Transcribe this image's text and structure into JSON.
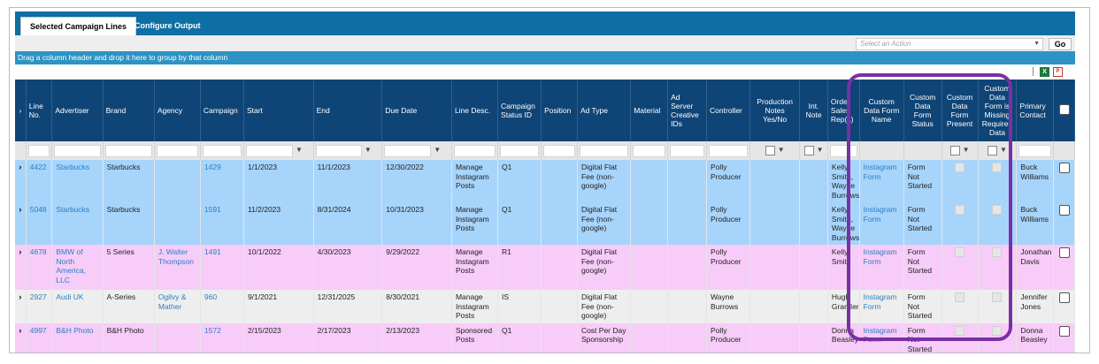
{
  "tabs": [
    {
      "label": "Selected Campaign Lines",
      "active": true
    },
    {
      "label": "Configure Output",
      "active": false
    }
  ],
  "action": {
    "placeholder": "Select an Action",
    "go_label": "Go"
  },
  "group_hint": "Drag a column header and drop it here to group by that column",
  "export": {
    "excel_icon": "excel-icon",
    "pdf_icon": "pdf-icon"
  },
  "columns": {
    "line_no": "Line No.",
    "advertiser": "Advertiser",
    "brand": "Brand",
    "agency": "Agency",
    "campaign": "Campaign",
    "start": "Start",
    "end": "End",
    "due_date": "Due Date",
    "line_desc": "Line Desc.",
    "campaign_status_id": "Campaign Status ID",
    "position": "Position",
    "ad_type": "Ad Type",
    "material": "Material",
    "ad_server_creative_ids": "Ad Server Creative IDs",
    "controller": "Controller",
    "production_notes": "Production Notes Yes/No",
    "int_note": "Int. Note",
    "order_sales_reps": "Order Sales Rep(s)",
    "custom_data_form_name": "Custom Data Form Name",
    "custom_data_form_status": "Custom Data Form Status",
    "custom_data_form_present": "Custom Data Form Present",
    "custom_data_form_missing": "Custom Data Form is Missing Required Data",
    "primary_contact": "Primary Contact"
  },
  "rows": [
    {
      "line_no": "4422",
      "advertiser": "Starbucks",
      "brand": "Starbucks",
      "agency": "",
      "campaign": "1429",
      "start": "1/1/2023",
      "end": "11/1/2023",
      "due_date": "12/30/2022",
      "line_desc": "Manage Instagram Posts",
      "status_id": "Q1",
      "position": "",
      "ad_type": "Digital Flat Fee (non-google)",
      "material": "",
      "ad_server": "",
      "controller": "Polly Producer",
      "prod_notes": "",
      "int_note": "",
      "sales_reps": "Kelly Smith, Wayne Burrows",
      "form_name": "Instagram Form",
      "form_status": "Form Not Started",
      "primary_contact": "Buck Williams"
    },
    {
      "line_no": "5048",
      "advertiser": "Starbucks",
      "brand": "Starbucks",
      "agency": "",
      "campaign": "1591",
      "start": "11/2/2023",
      "end": "8/31/2024",
      "due_date": "10/31/2023",
      "line_desc": "Manage Instagram Posts",
      "status_id": "Q1",
      "position": "",
      "ad_type": "Digital Flat Fee (non-google)",
      "material": "",
      "ad_server": "",
      "controller": "Polly Producer",
      "prod_notes": "",
      "int_note": "",
      "sales_reps": "Kelly Smith, Wayne Burrows",
      "form_name": "Instagram Form",
      "form_status": "Form Not Started",
      "primary_contact": "Buck Williams"
    },
    {
      "line_no": "4678",
      "advertiser": "BMW of North America, LLC",
      "brand": "5 Series",
      "agency": "J. Walter Thompson",
      "campaign": "1491",
      "start": "10/1/2022",
      "end": "4/30/2023",
      "due_date": "9/29/2022",
      "line_desc": "Manage Instagram Posts",
      "status_id": "R1",
      "position": "",
      "ad_type": "Digital Flat Fee (non-google)",
      "material": "",
      "ad_server": "",
      "controller": "Polly Producer",
      "prod_notes": "",
      "int_note": "",
      "sales_reps": "Kelly Smith",
      "form_name": "Instagram Form",
      "form_status": "Form Not Started",
      "primary_contact": "Jonathan Davis"
    },
    {
      "line_no": "2927",
      "advertiser": "Audi UK",
      "brand": "A-Series",
      "agency": "Ogilvy & Mather",
      "campaign": "960",
      "start": "9/1/2021",
      "end": "12/31/2025",
      "due_date": "8/30/2021",
      "line_desc": "Manage Instagram Posts",
      "status_id": "IS",
      "position": "",
      "ad_type": "Digital Flat Fee (non-google)",
      "material": "",
      "ad_server": "",
      "controller": "Wayne Burrows",
      "prod_notes": "",
      "int_note": "",
      "sales_reps": "Hugh Grantler",
      "form_name": "Instagram Form",
      "form_status": "Form Not Started",
      "primary_contact": "Jennifer Jones"
    },
    {
      "line_no": "4997",
      "advertiser": "B&H Photo",
      "brand": "B&H Photo",
      "agency": "",
      "campaign": "1572",
      "start": "2/15/2023",
      "end": "2/17/2023",
      "due_date": "2/13/2023",
      "line_desc": "Sponsored Posts",
      "status_id": "Q1",
      "position": "",
      "ad_type": "Cost Per Day Sponsorship",
      "material": "",
      "ad_server": "",
      "controller": "Polly Producer",
      "prod_notes": "",
      "int_note": "",
      "sales_reps": "Donna Beasley",
      "form_name": "Instagram Form",
      "form_status": "Form Not Started",
      "primary_contact": "Donna Beasley"
    }
  ],
  "colors": {
    "header_bg": "#0f4476",
    "tab_bar": "#0e6fa4",
    "group_bar": "#2e93c4",
    "row_blue": "#a7d4fb",
    "row_pink": "#f7ccf8",
    "row_gray": "#eeeeee",
    "link": "#2b7fc3",
    "highlight": "#7a2fa6"
  }
}
